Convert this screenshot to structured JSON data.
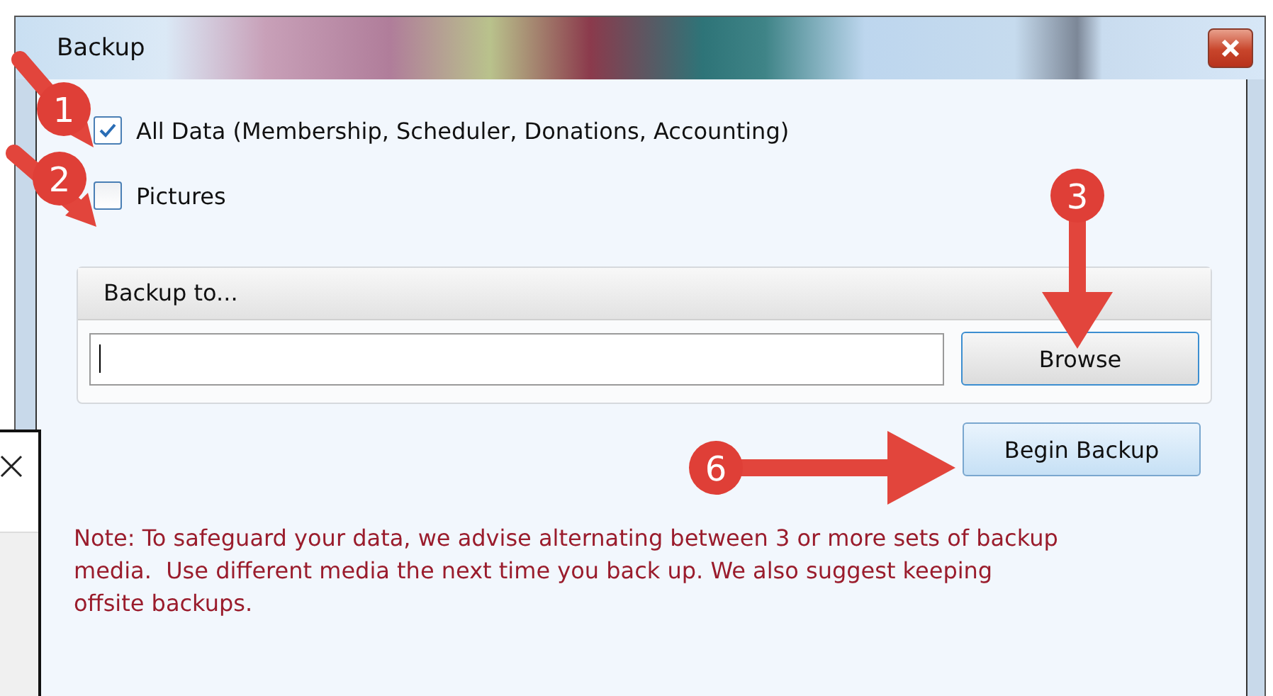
{
  "window": {
    "title": "Backup"
  },
  "options": [
    {
      "label": "All Data (Membership, Scheduler, Donations, Accounting)",
      "checked": true
    },
    {
      "label": "Pictures",
      "checked": false
    }
  ],
  "backup_to": {
    "heading": "Backup to...",
    "browse_button": "Browse"
  },
  "begin_button": "Begin Backup",
  "note": "Note: To safeguard your data, we advise alternating between 3 or more sets of backup media.  Use different media the next time you back up. We also suggest keeping offsite backups.",
  "callouts": [
    {
      "label": "1"
    },
    {
      "label": "2"
    },
    {
      "label": "3"
    },
    {
      "label": "6"
    }
  ]
}
